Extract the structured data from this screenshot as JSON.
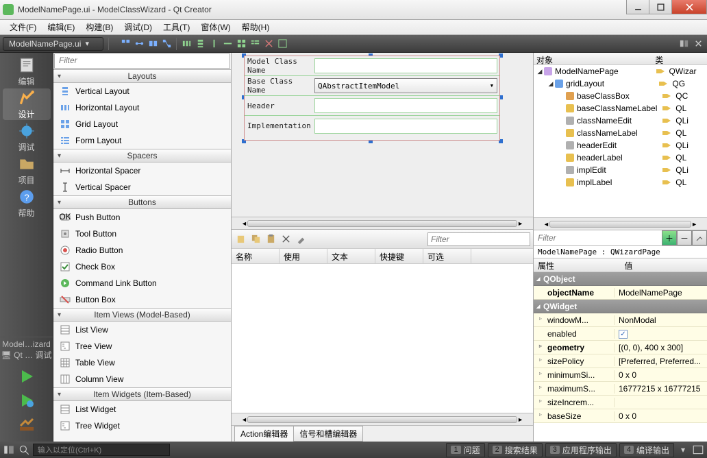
{
  "title": "ModelNamePage.ui - ModelClassWizard - Qt Creator",
  "menubar": [
    "文件(F)",
    "编辑(E)",
    "构建(B)",
    "调试(D)",
    "工具(T)",
    "窗体(W)",
    "帮助(H)"
  ],
  "open_tab": "ModelNamePage.ui",
  "modes": [
    {
      "id": "edit",
      "label": "编辑"
    },
    {
      "id": "design",
      "label": "设计",
      "active": true
    },
    {
      "id": "debug",
      "label": "调试"
    },
    {
      "id": "projects",
      "label": "项目"
    },
    {
      "id": "help",
      "label": "帮助"
    }
  ],
  "kit_label": "Model…izard",
  "kit_sub": "Qt … 调试",
  "widgetbox": {
    "filter_placeholder": "Filter",
    "groups": [
      {
        "title": "Layouts",
        "items": [
          {
            "icon": "layout-v",
            "label": "Vertical Layout"
          },
          {
            "icon": "layout-h",
            "label": "Horizontal Layout"
          },
          {
            "icon": "layout-grid",
            "label": "Grid Layout"
          },
          {
            "icon": "layout-form",
            "label": "Form Layout"
          }
        ]
      },
      {
        "title": "Spacers",
        "items": [
          {
            "icon": "spacer-h",
            "label": "Horizontal Spacer"
          },
          {
            "icon": "spacer-v",
            "label": "Vertical Spacer"
          }
        ]
      },
      {
        "title": "Buttons",
        "items": [
          {
            "icon": "btn-ok",
            "label": "Push Button"
          },
          {
            "icon": "btn-tool",
            "label": "Tool Button"
          },
          {
            "icon": "btn-radio",
            "label": "Radio Button"
          },
          {
            "icon": "btn-check",
            "label": "Check Box"
          },
          {
            "icon": "btn-cmdlink",
            "label": "Command Link Button"
          },
          {
            "icon": "btn-box",
            "label": "Button Box"
          }
        ]
      },
      {
        "title": "Item Views (Model-Based)",
        "items": [
          {
            "icon": "view-list",
            "label": "List View"
          },
          {
            "icon": "view-tree",
            "label": "Tree View"
          },
          {
            "icon": "view-table",
            "label": "Table View"
          },
          {
            "icon": "view-column",
            "label": "Column View"
          }
        ]
      },
      {
        "title": "Item Widgets (Item-Based)",
        "items": [
          {
            "icon": "view-list",
            "label": "List Widget"
          },
          {
            "icon": "view-tree",
            "label": "Tree Widget"
          }
        ]
      }
    ]
  },
  "form": {
    "rows": [
      {
        "label": "Model Class Name",
        "type": "text",
        "value": ""
      },
      {
        "label": "Base Class Name",
        "type": "select",
        "value": "QAbstractItemModel"
      },
      {
        "label": "Header",
        "type": "text",
        "value": ""
      },
      {
        "label": "Implementation",
        "type": "text",
        "value": ""
      }
    ]
  },
  "action_editor": {
    "filter_placeholder": "Filter",
    "columns": [
      "名称",
      "使用",
      "文本",
      "快捷键",
      "可选"
    ],
    "tabs": [
      "Action编辑器",
      "信号和槽编辑器"
    ],
    "active_tab": 0
  },
  "object_inspector": {
    "headers": [
      "对象",
      "类"
    ],
    "tree": [
      {
        "level": 0,
        "exp": "◢",
        "icon": "page",
        "name": "ModelNamePage",
        "cls": "QWizar"
      },
      {
        "level": 1,
        "exp": "◢",
        "icon": "grid",
        "name": "gridLayout",
        "cls": "QG"
      },
      {
        "level": 2,
        "exp": "",
        "icon": "combo",
        "name": "baseClassBox",
        "cls": "QC"
      },
      {
        "level": 2,
        "exp": "",
        "icon": "label",
        "name": "baseClassNameLabel",
        "cls": "QL"
      },
      {
        "level": 2,
        "exp": "",
        "icon": "edit",
        "name": "classNameEdit",
        "cls": "QLi"
      },
      {
        "level": 2,
        "exp": "",
        "icon": "label",
        "name": "classNameLabel",
        "cls": "QL"
      },
      {
        "level": 2,
        "exp": "",
        "icon": "edit",
        "name": "headerEdit",
        "cls": "QLi"
      },
      {
        "level": 2,
        "exp": "",
        "icon": "label",
        "name": "headerLabel",
        "cls": "QL"
      },
      {
        "level": 2,
        "exp": "",
        "icon": "edit",
        "name": "implEdit",
        "cls": "QLi"
      },
      {
        "level": 2,
        "exp": "",
        "icon": "label",
        "name": "implLabel",
        "cls": "QL"
      }
    ],
    "filter_placeholder": "Filter",
    "breadcrumb": "ModelNamePage : QWizardPage"
  },
  "property_editor": {
    "headers": [
      "属性",
      "值"
    ],
    "groups": [
      {
        "title": "QObject",
        "rows": [
          {
            "k": "objectName",
            "v": "ModelNamePage",
            "bold": true
          }
        ]
      },
      {
        "title": "QWidget",
        "rows": [
          {
            "k": "windowM...",
            "v": "NonModal",
            "exp": true
          },
          {
            "k": "enabled",
            "v": "",
            "check": true
          },
          {
            "k": "geometry",
            "v": "[(0, 0), 400 x 300]",
            "exp": true,
            "bold": true
          },
          {
            "k": "sizePolicy",
            "v": "[Preferred, Preferred...",
            "exp": true
          },
          {
            "k": "minimumSi...",
            "v": "0 x 0",
            "exp": true
          },
          {
            "k": "maximumS...",
            "v": "16777215 x 16777215",
            "exp": true
          },
          {
            "k": "sizeIncrem...",
            "v": "",
            "exp": true
          },
          {
            "k": "baseSize",
            "v": "0 x 0",
            "exp": true
          }
        ]
      }
    ]
  },
  "statusbar": {
    "locator_placeholder": "输入以定位(Ctrl+K)",
    "panes": [
      {
        "n": "1",
        "label": "问题"
      },
      {
        "n": "2",
        "label": "搜索结果"
      },
      {
        "n": "3",
        "label": "应用程序输出"
      },
      {
        "n": "4",
        "label": "编译输出"
      }
    ]
  }
}
